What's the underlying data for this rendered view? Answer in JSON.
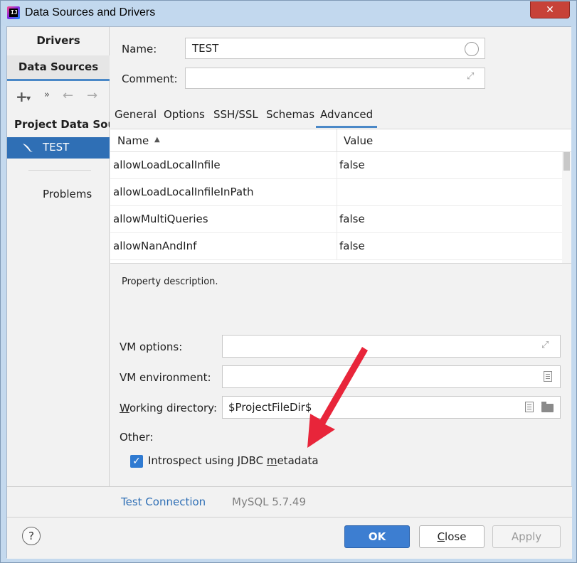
{
  "window": {
    "title": "Data Sources and Drivers",
    "close_glyph": "✕"
  },
  "sidebar": {
    "tab_drivers": "Drivers",
    "tab_data_sources": "Data Sources",
    "tools": {
      "add": "+",
      "more": "»",
      "back": "←",
      "forward": "→"
    },
    "section_title": "Project Data Sou...",
    "items": [
      {
        "label": "TEST",
        "icon": "mysql-dolphin-icon"
      }
    ],
    "problems": "Problems"
  },
  "form": {
    "name_label": "Name:",
    "name_value": "TEST",
    "comment_label": "Comment:",
    "comment_value": ""
  },
  "tabs": [
    {
      "label": "General"
    },
    {
      "label": "Options"
    },
    {
      "label": "SSH/SSL"
    },
    {
      "label": "Schemas"
    },
    {
      "label": "Advanced",
      "active": true
    }
  ],
  "grid": {
    "col_name": "Name",
    "col_value": "Value",
    "sort_arrow": "▲",
    "rows": [
      {
        "name": "allowLoadLocalInfile",
        "value": "false"
      },
      {
        "name": "allowLoadLocalInfileInPath",
        "value": ""
      },
      {
        "name": "allowMultiQueries",
        "value": "false"
      },
      {
        "name": "allowNanAndInf",
        "value": "false"
      }
    ]
  },
  "property_description": "Property description.",
  "vm": {
    "options_label": "VM options:",
    "options_value": "",
    "environment_label": "VM environment:",
    "environment_value": "",
    "workdir_label_mnemonic": "W",
    "workdir_label_rest": "orking directory:",
    "workdir_value": "$ProjectFileDir$"
  },
  "other": {
    "label": "Other:",
    "introspect_checked": true,
    "introspect_label_pre": "Introspect using JDBC ",
    "introspect_label_mnemonic": "m",
    "introspect_label_post": "etadata"
  },
  "connection": {
    "test_connection": "Test Connection",
    "version": "MySQL 5.7.49"
  },
  "footer": {
    "help": "?",
    "ok": "OK",
    "close_mnemonic": "C",
    "close_rest": "lose",
    "apply": "Apply"
  },
  "colors": {
    "accent": "#2f6fb5",
    "selected_row": "#2f6fb5",
    "ok_button": "#3d7ed1",
    "annotation_arrow": "#e8253a"
  }
}
